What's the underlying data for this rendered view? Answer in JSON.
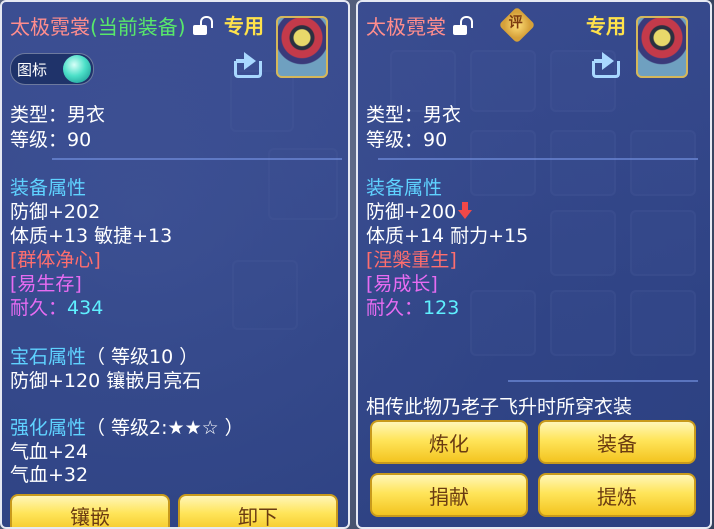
{
  "left_panel": {
    "title_name": "太极霓裳",
    "title_tag": "(当前装备)",
    "exclusive": "专用",
    "icon_toggle_label": "图标",
    "type": "类型：男衣",
    "level": "等级：90",
    "equip_attr_header": "装备属性",
    "defense": "防御+202",
    "stats": "体质+13 敏捷+13",
    "effect": "[群体净心]",
    "special": "[易生存]",
    "durability_label": "耐久：",
    "durability_value": "434",
    "gem_header": "宝石属性",
    "gem_level": "（ 等级10 ）",
    "gem_line": "防御+120 镶嵌月亮石",
    "enhance_header": "强化属性",
    "enhance_level": "（ 等级2:★★☆ ）",
    "enhance_hp1": "气血+24",
    "enhance_hp2": "气血+32",
    "buttons": {
      "inlay": "镶嵌",
      "unequip": "卸下"
    }
  },
  "right_panel": {
    "title_name": "太极霓裳",
    "review_badge": "评",
    "exclusive": "专用",
    "type": "类型：男衣",
    "level": "等级：90",
    "equip_attr_header": "装备属性",
    "defense": "防御+200",
    "stats": "体质+14 耐力+15",
    "effect": "[涅槃重生]",
    "special": "[易成长]",
    "durability_label": "耐久：",
    "durability_value": "123",
    "description": "相传此物乃老子飞升时所穿衣装",
    "buttons": {
      "refine": "炼化",
      "equip": "装备",
      "donate": "捐献",
      "extract": "提炼"
    }
  },
  "colors": {
    "title_name": "#ff8d8d",
    "title_tag": "#58e86a",
    "exclusive": "#ffe24a",
    "section": "#5fd2ff",
    "effect": "#ff6e6e",
    "special": "#e76cf2",
    "durability": "#5ff0ff",
    "button_text": "#6a3b12"
  }
}
